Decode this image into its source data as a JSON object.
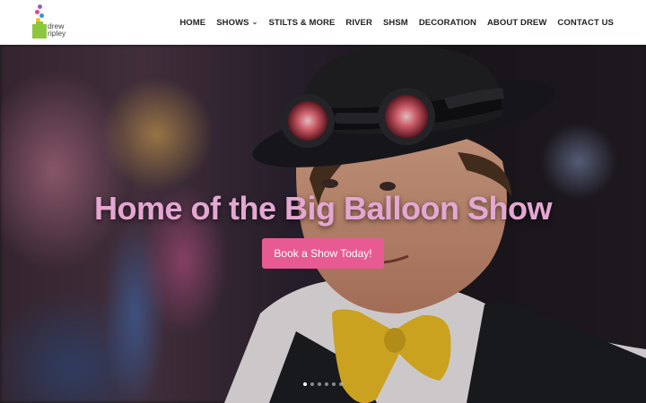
{
  "brand": {
    "logo_line1": "drew",
    "logo_line2": "ripley",
    "colors": {
      "green": "#8dc63f",
      "pink": "#e85a92",
      "title": "#e4a7d2"
    }
  },
  "nav": {
    "items": [
      {
        "label": "HOME"
      },
      {
        "label": "SHOWS",
        "has_dropdown": true
      },
      {
        "label": "STILTS & MORE"
      },
      {
        "label": "RIVER"
      },
      {
        "label": "SHSM"
      },
      {
        "label": "DECORATION"
      },
      {
        "label": "ABOUT DREW"
      },
      {
        "label": "CONTACT US"
      }
    ],
    "dropdown_icon": "chevron-down-icon"
  },
  "hero": {
    "title": "Home of the Big Balloon Show",
    "button_label": "Book a Show Today!",
    "slides": {
      "count": 6,
      "active_index": 0
    }
  }
}
